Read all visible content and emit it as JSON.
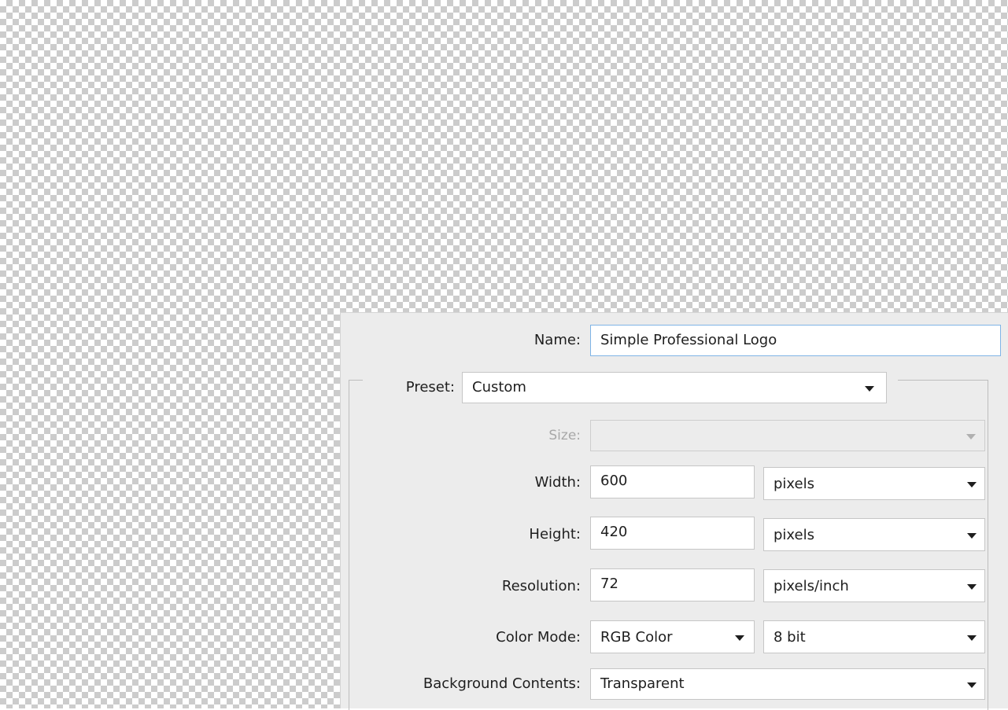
{
  "dialog": {
    "name_label": "Name:",
    "name_value": "Simple Professional Logo",
    "preset_label": "Preset:",
    "preset_value": "Custom",
    "size_label": "Size:",
    "size_value": "",
    "width_label": "Width:",
    "width_value": "600",
    "width_unit": "pixels",
    "height_label": "Height:",
    "height_value": "420",
    "height_unit": "pixels",
    "resolution_label": "Resolution:",
    "resolution_value": "72",
    "resolution_unit": "pixels/inch",
    "color_mode_label": "Color Mode:",
    "color_mode_value": "RGB Color",
    "bit_depth_value": "8 bit",
    "background_label": "Background Contents:",
    "background_value": "Transparent"
  },
  "colors": {
    "dialog_bg": "#ececec",
    "field_focus_border": "#7fb4e6",
    "checker_dark": "#cccccc",
    "checker_light": "#ffffff"
  },
  "icons": {
    "dropdown": "chevron-down-icon"
  }
}
